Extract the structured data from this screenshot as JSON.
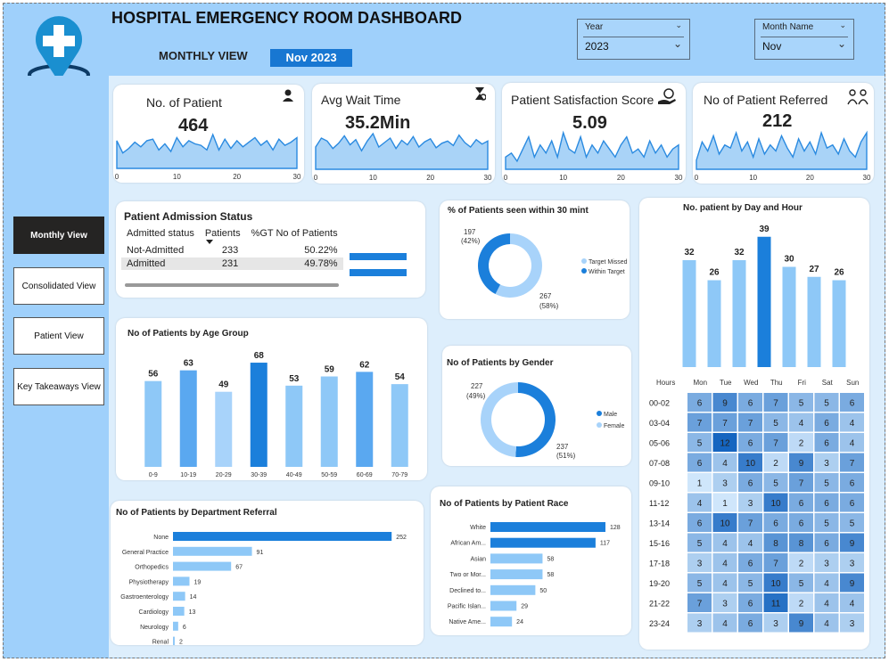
{
  "header": {
    "title": "HOSPITAL EMERGENCY ROOM DASHBOARD",
    "view_label": "MONTHLY VIEW",
    "period_badge": "Nov 2023",
    "year_slicer": {
      "label": "Year",
      "value": "2023"
    },
    "month_slicer": {
      "label": "Month Name",
      "value": "Nov"
    }
  },
  "nav": {
    "items": [
      {
        "label": "Monthly View",
        "active": true
      },
      {
        "label": "Consolidated View",
        "active": false
      },
      {
        "label": "Patient View",
        "active": false
      },
      {
        "label": "Key Takeaways View",
        "active": false
      }
    ]
  },
  "kpis": [
    {
      "title": "No. of Patient",
      "value": "464",
      "icon": "patient-icon"
    },
    {
      "title": "Avg Wait Time",
      "value": "35.2Min",
      "icon": "hourglass-icon"
    },
    {
      "title": "Patient Satisfaction Score",
      "value": "5.09",
      "icon": "satisfaction-hand-icon"
    },
    {
      "title": "No of Patient Referred",
      "value": "212",
      "icon": "referral-people-icon"
    }
  ],
  "kpi_axis_ticks": [
    "0",
    "10",
    "20",
    "30"
  ],
  "admission": {
    "title": "Patient Admission Status",
    "headers": [
      "Admitted status",
      "Patients",
      "%GT No of Patients"
    ],
    "rows": [
      {
        "status": "Not-Admitted",
        "patients": "233",
        "pct": "50.22%",
        "fraction": 0.5022
      },
      {
        "status": "Admitted",
        "patients": "231",
        "pct": "49.78%",
        "fraction": 0.4978
      }
    ]
  },
  "colors": {
    "dark_blue": "#1b7fdb",
    "light_blue": "#8ec8f7",
    "mid_blue": "#5aa8f0",
    "background": "#9fd0fb",
    "heat_low": "#cfe6fb",
    "heat_high": "#1565c0"
  },
  "chart_data": [
    {
      "id": "kpi_patients_trend",
      "type": "area",
      "x": [
        0,
        1,
        2,
        3,
        4,
        5,
        6,
        7,
        8,
        9,
        10,
        11,
        12,
        13,
        14,
        15,
        16,
        17,
        18,
        19,
        20,
        21,
        22,
        23,
        24,
        25,
        26,
        27,
        28,
        29,
        30
      ],
      "values": [
        18,
        10,
        13,
        17,
        14,
        18,
        19,
        12,
        16,
        11,
        20,
        14,
        18,
        16,
        15,
        12,
        22,
        12,
        19,
        13,
        18,
        14,
        17,
        20,
        15,
        18,
        12,
        19,
        15,
        17,
        20
      ],
      "xlim": [
        0,
        30
      ]
    },
    {
      "id": "kpi_wait_trend",
      "type": "area",
      "x": [
        0,
        1,
        2,
        3,
        4,
        5,
        6,
        7,
        8,
        9,
        10,
        11,
        12,
        13,
        14,
        15,
        16,
        17,
        18,
        19,
        20,
        21,
        22,
        23,
        24,
        25,
        26,
        27,
        28,
        29,
        30
      ],
      "values": [
        30,
        42,
        38,
        28,
        35,
        45,
        33,
        40,
        25,
        38,
        48,
        30,
        36,
        42,
        28,
        39,
        33,
        44,
        30,
        37,
        41,
        29,
        35,
        38,
        32,
        46,
        36,
        30,
        40,
        34,
        38
      ],
      "xlim": [
        0,
        30
      ]
    },
    {
      "id": "kpi_satisfaction_trend",
      "type": "area",
      "x": [
        0,
        1,
        2,
        3,
        4,
        5,
        6,
        7,
        8,
        9,
        10,
        11,
        12,
        13,
        14,
        15,
        16,
        17,
        18,
        19,
        20,
        21,
        22,
        23,
        24,
        25,
        26,
        27,
        28,
        29,
        30
      ],
      "values": [
        3,
        4,
        2,
        5,
        8,
        3,
        6,
        4,
        7,
        3,
        9,
        5,
        4,
        8,
        3,
        6,
        4,
        7,
        5,
        3,
        6,
        8,
        4,
        5,
        3,
        7,
        4,
        6,
        3,
        5,
        6
      ],
      "xlim": [
        0,
        30
      ]
    },
    {
      "id": "kpi_referred_trend",
      "type": "area",
      "x": [
        0,
        1,
        2,
        3,
        4,
        5,
        6,
        7,
        8,
        9,
        10,
        11,
        12,
        13,
        14,
        15,
        16,
        17,
        18,
        19,
        20,
        21,
        22,
        23,
        24,
        25,
        26,
        27,
        28,
        29,
        30
      ],
      "values": [
        3,
        9,
        6,
        11,
        5,
        8,
        7,
        12,
        6,
        9,
        4,
        10,
        5,
        8,
        6,
        11,
        7,
        4,
        10,
        6,
        9,
        5,
        12,
        7,
        8,
        5,
        10,
        6,
        4,
        9,
        12
      ],
      "xlim": [
        0,
        30
      ]
    },
    {
      "id": "seen_within_30",
      "type": "pie",
      "title": "% of Patients seen within 30 mint",
      "categories": [
        "Target Missed",
        "Within Target"
      ],
      "values": [
        267,
        197
      ],
      "labels": [
        "267\n(58%)",
        "197\n(42%)"
      ],
      "colors": [
        "#a8d3fa",
        "#1b7fdb"
      ]
    },
    {
      "id": "gender",
      "type": "pie",
      "title": "No of Patients by Gender",
      "categories": [
        "Male",
        "Female"
      ],
      "values": [
        237,
        227
      ],
      "pct_labels": [
        "(51%)",
        "(49%)"
      ],
      "colors": [
        "#1b7fdb",
        "#a8d3fa"
      ]
    },
    {
      "id": "age_group",
      "type": "bar",
      "title": "No of Patients by Age Group",
      "categories": [
        "0-9",
        "10-19",
        "20-29",
        "30-39",
        "40-49",
        "50-59",
        "60-69",
        "70-79"
      ],
      "values": [
        56,
        63,
        49,
        68,
        53,
        59,
        62,
        54
      ],
      "ylim": [
        0,
        75
      ]
    },
    {
      "id": "day_of_week",
      "type": "bar",
      "title": "No. patient by Day and Hour",
      "categories": [
        "Mon",
        "Tue",
        "Wed",
        "Thu",
        "Fri",
        "Sat",
        "Sun"
      ],
      "values": [
        32,
        26,
        32,
        39,
        30,
        27,
        26
      ],
      "ylim": [
        0,
        40
      ]
    },
    {
      "id": "department",
      "type": "bar",
      "orientation": "horizontal",
      "title": "No of Patients by Department Referral",
      "categories": [
        "None",
        "General Practice",
        "Orthopedics",
        "Physiotherapy",
        "Gastroenterology",
        "Cardiology",
        "Neurology",
        "Renal"
      ],
      "values": [
        252,
        91,
        67,
        19,
        14,
        13,
        6,
        2
      ],
      "xlim": [
        0,
        260
      ]
    },
    {
      "id": "race",
      "type": "bar",
      "orientation": "horizontal",
      "title": "No of Patients by Patient Race",
      "categories": [
        "White",
        "African Am...",
        "Asian",
        "Two or Mor...",
        "Declined to...",
        "Pacific Islan...",
        "Native Ame..."
      ],
      "values": [
        128,
        117,
        58,
        58,
        50,
        29,
        24
      ],
      "xlim": [
        0,
        130
      ]
    },
    {
      "id": "day_hour_heatmap",
      "type": "heatmap",
      "row_header": "Hours",
      "columns": [
        "Mon",
        "Tue",
        "Wed",
        "Thu",
        "Fri",
        "Sat",
        "Sun"
      ],
      "rows": [
        "00-02",
        "03-04",
        "05-06",
        "07-08",
        "09-10",
        "11-12",
        "13-14",
        "15-16",
        "17-18",
        "19-20",
        "21-22",
        "23-24"
      ],
      "values": [
        [
          6,
          9,
          6,
          7,
          5,
          5,
          6
        ],
        [
          7,
          7,
          7,
          5,
          4,
          6,
          4
        ],
        [
          5,
          12,
          6,
          7,
          2,
          6,
          4
        ],
        [
          6,
          4,
          10,
          2,
          9,
          3,
          7
        ],
        [
          1,
          3,
          6,
          5,
          7,
          5,
          6
        ],
        [
          4,
          1,
          3,
          10,
          6,
          6,
          6
        ],
        [
          6,
          10,
          7,
          6,
          6,
          5,
          5
        ],
        [
          5,
          4,
          4,
          8,
          8,
          6,
          9
        ],
        [
          3,
          4,
          6,
          7,
          2,
          3,
          3
        ],
        [
          5,
          4,
          5,
          10,
          5,
          4,
          9
        ],
        [
          7,
          3,
          6,
          11,
          2,
          4,
          4
        ],
        [
          3,
          4,
          6,
          3,
          9,
          4,
          3
        ]
      ]
    }
  ]
}
